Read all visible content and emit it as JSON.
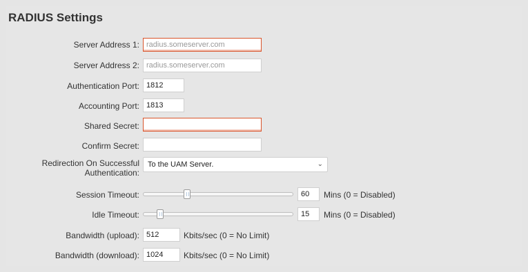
{
  "section": {
    "title": "RADIUS Settings"
  },
  "fields": {
    "server1": {
      "label": "Server Address 1:",
      "placeholder": "radius.someserver.com"
    },
    "server2": {
      "label": "Server Address 2:",
      "placeholder": "radius.someserver.com"
    },
    "auth_port": {
      "label": "Authentication Port:",
      "value": "1812"
    },
    "acct_port": {
      "label": "Accounting Port:",
      "value": "1813"
    },
    "shared_secret": {
      "label": "Shared Secret:",
      "value": ""
    },
    "confirm_secret": {
      "label": "Confirm Secret:",
      "value": ""
    },
    "redirection": {
      "label": "Redirection On Successful Authentication:",
      "selected": "To the UAM Server."
    },
    "session_timeout": {
      "label": "Session Timeout:",
      "value": "60",
      "unit": "Mins (0 = Disabled)",
      "slider_level": 0.26
    },
    "idle_timeout": {
      "label": "Idle Timeout:",
      "value": "15",
      "unit": "Mins (0 = Disabled)",
      "slider_level": 0.07
    },
    "bandwidth_upload": {
      "label": "Bandwidth (upload):",
      "value": "512",
      "unit": "Kbits/sec (0 = No Limit)"
    },
    "bandwidth_download": {
      "label": "Bandwidth (download):",
      "value": "1024",
      "unit": "Kbits/sec (0 = No Limit)"
    }
  },
  "colors": {
    "error_border": "#d9532a",
    "background": "#e6e6e6"
  },
  "icons": {
    "select_arrow": "chevron-down-icon",
    "slider_handle": "slider-grip-icon"
  }
}
